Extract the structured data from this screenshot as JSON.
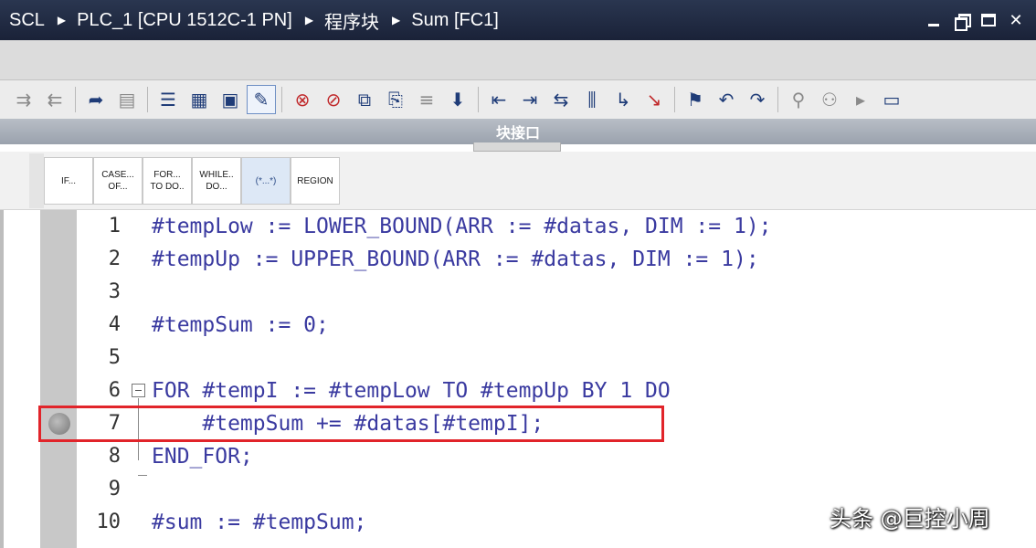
{
  "titlebar": {
    "breadcrumbs": [
      "SCL",
      "PLC_1 [CPU 1512C-1 PN]",
      "程序块",
      "Sum [FC1]"
    ],
    "window_controls": [
      "minimize",
      "restore",
      "maximize",
      "close"
    ]
  },
  "interface_bar": {
    "label": "块接口"
  },
  "templates": [
    {
      "label": "IF..."
    },
    {
      "label": "CASE...\nOF..."
    },
    {
      "label": "FOR...\nTO DO.."
    },
    {
      "label": "WHILE..\nDO..."
    },
    {
      "label": "(*...*)"
    },
    {
      "label": "REGION"
    }
  ],
  "code_lines": [
    {
      "num": "1",
      "text": "#tempLow := LOWER_BOUND(ARR := #datas, DIM := 1);"
    },
    {
      "num": "2",
      "text": "#tempUp := UPPER_BOUND(ARR := #datas, DIM := 1);"
    },
    {
      "num": "3",
      "text": ""
    },
    {
      "num": "4",
      "text": "#tempSum := 0;"
    },
    {
      "num": "5",
      "text": ""
    },
    {
      "num": "6",
      "text": "FOR #tempI := #tempLow TO #tempUp BY 1 DO"
    },
    {
      "num": "7",
      "text": "    #tempSum += #datas[#tempI];"
    },
    {
      "num": "8",
      "text": "END_FOR;"
    },
    {
      "num": "9",
      "text": ""
    },
    {
      "num": "10",
      "text": "#sum := #tempSum;"
    }
  ],
  "watermark": "头条 @巨控小周",
  "colors": {
    "highlight_box": "#e1242a",
    "title_bg": "#1f2942"
  }
}
